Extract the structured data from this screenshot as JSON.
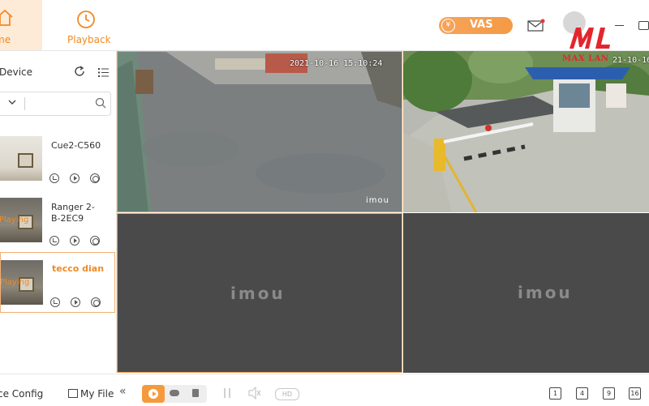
{
  "nav": {
    "home_label": "me",
    "playback_label": "Playback"
  },
  "header": {
    "vas_label": "VAS",
    "logo_text": "MAX LAN"
  },
  "sidebar": {
    "title": "Device",
    "search": {
      "value": "",
      "placeholder": ""
    },
    "devices": [
      {
        "name": "Cue2-C560",
        "status": ""
      },
      {
        "name": "Ranger 2-B-2EC9",
        "status": "Playing"
      },
      {
        "name": "tecco dian",
        "status": "Playing"
      }
    ]
  },
  "video": {
    "cells": [
      {
        "timestamp": "2021-10-16 15:10:24",
        "watermark": "imou"
      },
      {
        "timestamp": "21-10-16",
        "watermark": ""
      },
      {
        "placeholder": "imou"
      },
      {
        "placeholder": "imou"
      }
    ]
  },
  "bottombar": {
    "device_config_label": "ce Config",
    "my_file_label": "My File",
    "collapse_glyph": "«",
    "hd_label": "HD",
    "layouts": [
      "1",
      "4",
      "9",
      "16"
    ]
  },
  "colors": {
    "accent": "#f08a24",
    "active_border": "#f3b074",
    "empty_cell": "#4a4a4a"
  }
}
